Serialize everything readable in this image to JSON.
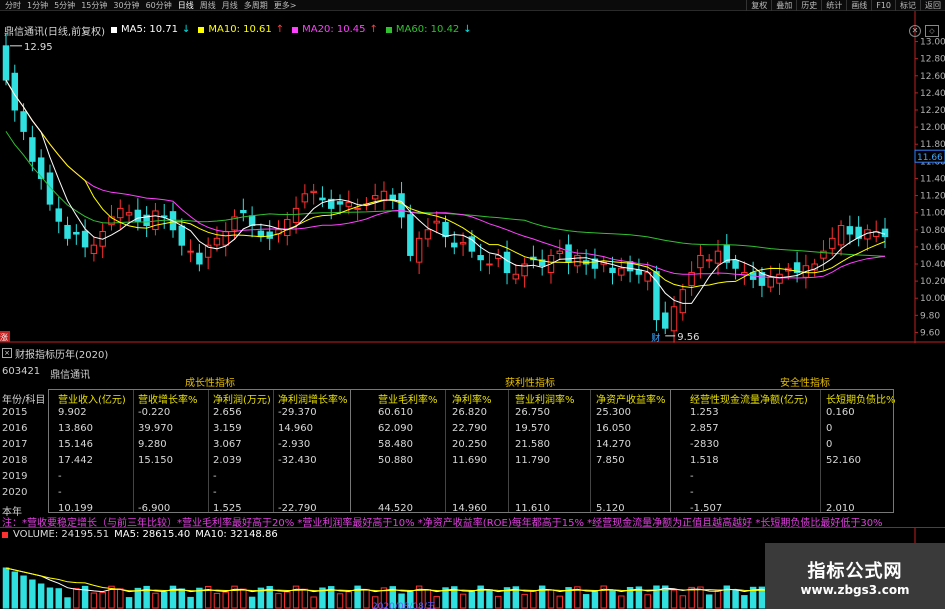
{
  "toolbar": {
    "periods": [
      "分时",
      "1分钟",
      "5分钟",
      "15分钟",
      "30分钟",
      "60分钟",
      "日线",
      "周线",
      "月线",
      "多周期",
      "更多>"
    ],
    "active_period": "日线",
    "tools": [
      "复权",
      "叠加",
      "历史",
      "统计",
      "画线",
      "F10",
      "标记",
      "返回"
    ]
  },
  "chart": {
    "title": "鼎信通讯(日线,前复权)",
    "indicators": [
      {
        "label": "MA5: 10.71",
        "dir": "down",
        "color": "#ffffff"
      },
      {
        "label": "MA10: 10.61",
        "dir": "up",
        "color": "#ffff00"
      },
      {
        "label": "MA20: 10.45",
        "dir": "up",
        "color": "#ff40ff"
      },
      {
        "label": "MA60: 10.42",
        "dir": "down",
        "color": "#30c030"
      }
    ],
    "price_axis": [
      "13.00",
      "12.80",
      "12.60",
      "12.40",
      "12.20",
      "12.00",
      "11.80",
      "11.60",
      "11.40",
      "11.20",
      "11.00",
      "10.80",
      "10.60",
      "10.40",
      "10.20",
      "10.00",
      "9.80",
      "9.60"
    ],
    "current_price": "11.66",
    "high_label": "12.95",
    "low_label": "9.56",
    "cai_label": "财",
    "zhang_label": "涨",
    "close_icon": "✕",
    "max_icon": "◇"
  },
  "fin": {
    "title": "财报指标历年(2020)",
    "tag": "×",
    "code": "603421",
    "name": "鼎信通讯",
    "categories": [
      "成长性指标",
      "获利性指标",
      "安全性指标"
    ],
    "row_header": "年份/科目",
    "col_headers": [
      "营业收入(亿元)",
      "营收增长率%",
      "净利润(万元)",
      "净利润增长率%",
      "营业毛利率%",
      "净利率%",
      "营业利润率%",
      "净资产收益率%",
      "经营性现金流量净额(亿元)",
      "长短期负债比%"
    ],
    "rows": [
      {
        "year": "2015",
        "cells": [
          "9.902",
          "-0.220",
          "2.656",
          "-29.370",
          "60.610",
          "26.820",
          "26.750",
          "25.300",
          "1.253",
          "0.160"
        ]
      },
      {
        "year": "2016",
        "cells": [
          "13.860",
          "39.970",
          "3.159",
          "14.960",
          "62.090",
          "22.790",
          "19.570",
          "16.050",
          "2.857",
          "0"
        ]
      },
      {
        "year": "2017",
        "cells": [
          "15.146",
          "9.280",
          "3.067",
          "-2.930",
          "58.480",
          "20.250",
          "21.580",
          "14.270",
          "-2830",
          "0"
        ]
      },
      {
        "year": "2018",
        "cells": [
          "17.442",
          "15.150",
          "2.039",
          "-32.430",
          "50.880",
          "11.690",
          "11.790",
          "7.850",
          "1.518",
          "52.160"
        ]
      },
      {
        "year": "2019",
        "cells": [
          "-",
          "",
          "-",
          "",
          "",
          "",
          "",
          "",
          "-",
          ""
        ]
      },
      {
        "year": "2020",
        "cells": [
          "-",
          "",
          "-",
          "",
          "",
          "",
          "",
          "",
          "-",
          ""
        ]
      },
      {
        "year": "本年",
        "cells": [
          "10.199",
          "-6.900",
          "1.525",
          "-22.790",
          "44.520",
          "14.960",
          "11.610",
          "5.120",
          "-1.507",
          "2.010"
        ]
      }
    ],
    "note": "注：*营收要稳定增长（与前三年比较）*营业毛利率最好高于20% *营业利润率最好高于10% *净资产收益率(ROE)每年都高于15%    *经营现金流量净额为正值且越高越好 *长短期负债比最好低于30%"
  },
  "volume": {
    "label": "VOLUME: 24195.51",
    "ma5": "MA5: 28615.40",
    "ma10": "MA10: 32148.86",
    "bottom_date": "2020/08/08/五"
  },
  "watermark": {
    "line1": "指标公式网",
    "line2": "www.zbgs3.com"
  },
  "colors": {
    "up": "#ff3030",
    "down": "#30e0e0",
    "ma5": "#ffffff",
    "ma10": "#ffff00",
    "ma20": "#ff40ff",
    "ma60": "#30c030"
  }
}
